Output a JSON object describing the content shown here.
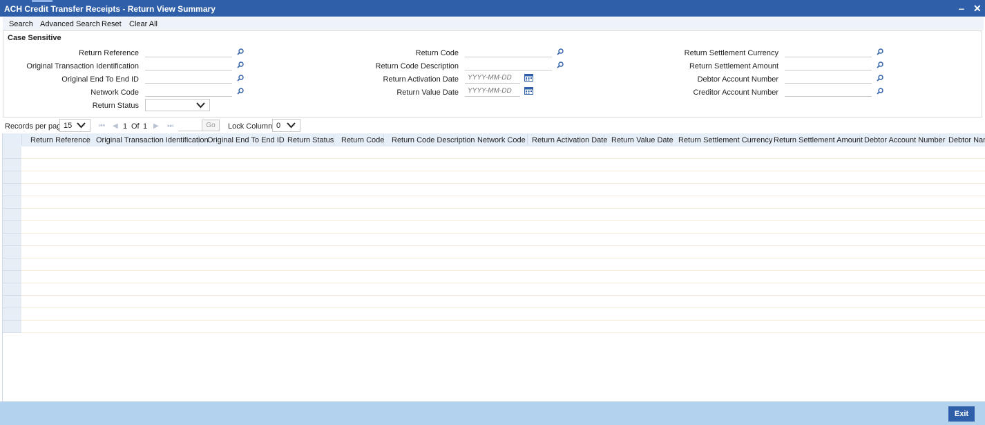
{
  "window": {
    "title": "ACH Credit Transfer Receipts - Return View Summary",
    "minimize": "‒",
    "close": "✕"
  },
  "toolbar": {
    "search": "Search",
    "advanced_search": "Advanced Search",
    "reset": "Reset",
    "clear_all": "Clear All"
  },
  "criteria": {
    "legend": "Case Sensitive",
    "return_reference": "Return Reference",
    "original_transaction_identification": "Original Transaction Identification",
    "original_end_to_end_id": "Original End To End ID",
    "network_code": "Network Code",
    "return_status": "Return Status",
    "return_code": "Return Code",
    "return_code_description": "Return Code Description",
    "return_activation_date": "Return Activation Date",
    "return_value_date": "Return Value Date",
    "date_placeholder": "YYYY-MM-DD",
    "return_settlement_currency": "Return Settlement Currency",
    "return_settlement_amount": "Return Settlement Amount",
    "debtor_account_number": "Debtor Account Number",
    "creditor_account_number": "Creditor Account Number"
  },
  "pager": {
    "records_per_page_label": "Records per page",
    "records_per_page": "15",
    "current_page": "1",
    "of_label": "Of",
    "total_pages": "1",
    "go": "Go",
    "lock_columns_label": "Lock Columns",
    "lock_columns": "0"
  },
  "grid": {
    "columns": [
      "Return Reference",
      "Original Transaction Identification",
      "Original End To End ID",
      "Return Status",
      "Return Code",
      "Return Code Description",
      "Network Code",
      "Return Activation Date",
      "Return Value Date",
      "Return Settlement Currency",
      "Return Settlement Amount",
      "Debtor Account Number",
      "Debtor Nam"
    ],
    "row_count": 15
  },
  "footer": {
    "exit": "Exit"
  }
}
